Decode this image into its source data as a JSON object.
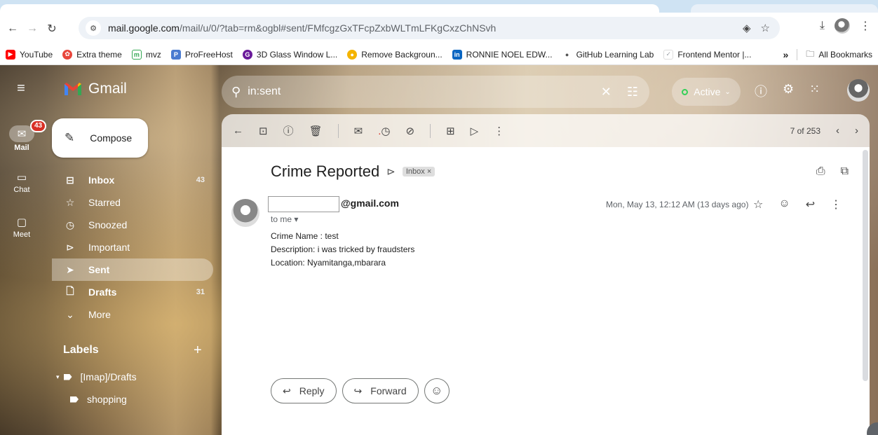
{
  "browser": {
    "url_domain": "mail.google.com",
    "url_path": "/mail/u/0/?tab=rm&ogbl#sent/FMfcgzGxTFcpZxbWLTmLFKgCxzChNSvh",
    "bookmarks": [
      {
        "label": "YouTube",
        "color": "#ff0000"
      },
      {
        "label": "Extra theme",
        "color": "#e8463c"
      },
      {
        "label": "mvz",
        "color": "#34a853"
      },
      {
        "label": "ProFreeHost",
        "color": "#4a7bd0"
      },
      {
        "label": "3D Glass Window L...",
        "color": "#6a1b9a"
      },
      {
        "label": "Remove Backgroun...",
        "color": "#f4b400"
      },
      {
        "label": "RONNIE NOEL EDW...",
        "color": "#0a66c2"
      },
      {
        "label": "GitHub Learning Lab",
        "color": "#555555"
      },
      {
        "label": "Frontend Mentor |...",
        "color": "#9aa0a6"
      }
    ],
    "more_bookmarks": "»",
    "all_bookmarks": "All Bookmarks"
  },
  "rail": {
    "mail_label": "Mail",
    "mail_badge": "43",
    "chat_label": "Chat",
    "meet_label": "Meet"
  },
  "app": {
    "name": "Gmail",
    "compose": "Compose"
  },
  "nav": [
    {
      "label": "Inbox",
      "icon": "inbox-icon",
      "glyph": "⊟",
      "count": "43",
      "bold": true
    },
    {
      "label": "Starred",
      "icon": "star-icon",
      "glyph": "☆",
      "count": "",
      "bold": false
    },
    {
      "label": "Snoozed",
      "icon": "clock-icon",
      "glyph": "◷",
      "count": "",
      "bold": false
    },
    {
      "label": "Important",
      "icon": "important-icon",
      "glyph": "⊳",
      "count": "",
      "bold": false
    },
    {
      "label": "Sent",
      "icon": "sent-icon",
      "glyph": "➤",
      "count": "",
      "bold": false,
      "active": true
    },
    {
      "label": "Drafts",
      "icon": "draft-icon",
      "glyph": "🗋",
      "count": "31",
      "bold": true
    },
    {
      "label": "More",
      "icon": "chevron-down-icon",
      "glyph": "⌄",
      "count": "",
      "bold": false
    }
  ],
  "labels": {
    "heading": "Labels",
    "add": "+",
    "items": [
      "[Imap]/Drafts",
      "shopping"
    ]
  },
  "search": {
    "value": "in:sent"
  },
  "status": {
    "label": "Active"
  },
  "pane": {
    "counter": "7 of 253",
    "subject": "Crime Reported",
    "label_chip": "Inbox ×",
    "sender_email": "@gmail.com",
    "to": "to me ▾",
    "date": "Mon, May 13, 12:12 AM (13 days ago)",
    "body": [
      "Crime Name : test",
      "Description: i was tricked by fraudsters",
      "Location: Nyamitanga,mbarara"
    ],
    "reply": "Reply",
    "forward": "Forward"
  }
}
